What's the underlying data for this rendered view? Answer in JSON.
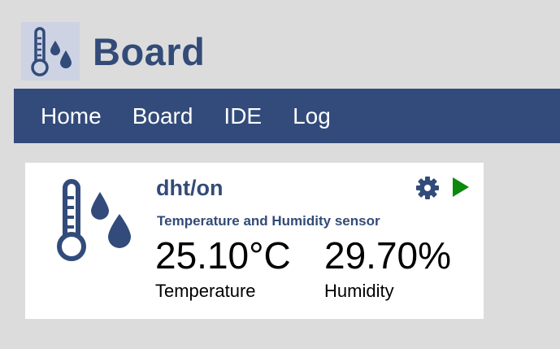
{
  "app": {
    "title": "Board"
  },
  "nav": {
    "items": [
      "Home",
      "Board",
      "IDE",
      "Log"
    ]
  },
  "card": {
    "title": "dht/on",
    "subtitle": "Temperature and Humidity sensor",
    "icon": "thermometer-drops-icon",
    "actions": {
      "settings_icon": "gear-icon",
      "run_icon": "play-icon",
      "run_color": "#0b8a0b"
    },
    "readings": {
      "temperature": {
        "value": "25.10°C",
        "label": "Temperature"
      },
      "humidity": {
        "value": "29.70%",
        "label": "Humidity"
      }
    }
  },
  "colors": {
    "brand": "#324b7b",
    "background": "#dcdcdc",
    "logo_bg": "#cdd3e3"
  }
}
